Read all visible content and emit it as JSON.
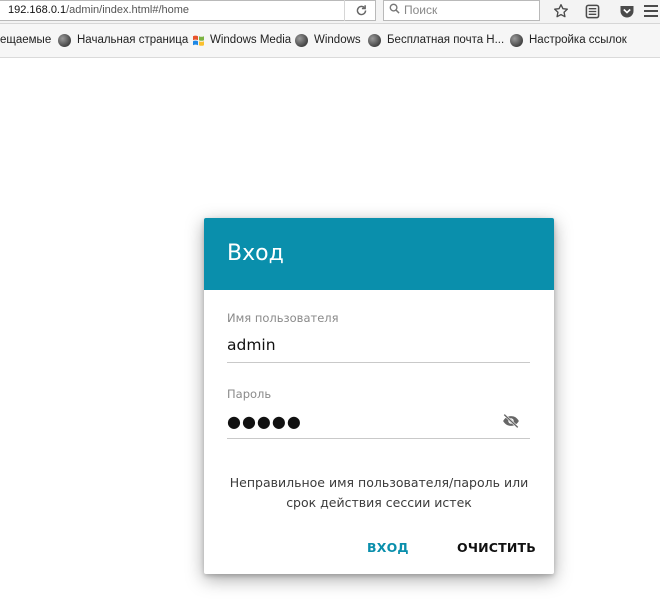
{
  "browser": {
    "url_host": "192.168.0.1",
    "url_path": "/admin/index.html#/home",
    "search_placeholder": "Поиск"
  },
  "bookmarks": [
    {
      "label": "ещаемые",
      "icon": "none"
    },
    {
      "label": "Начальная страница",
      "icon": "globe-icon"
    },
    {
      "label": "Windows Media",
      "icon": "windows-flag-icon"
    },
    {
      "label": "Windows",
      "icon": "globe-icon"
    },
    {
      "label": "Бесплатная почта Н...",
      "icon": "globe-icon"
    },
    {
      "label": "Настройка ссылок",
      "icon": "globe-icon"
    }
  ],
  "dialog": {
    "title": "Вход",
    "username_label": "Имя пользователя",
    "username_value": "admin",
    "password_label": "Пароль",
    "password_masked": "●●●●●",
    "error_line1": "Неправильное имя пользователя/пароль или",
    "error_line2": "срок действия сессии истек",
    "login_button": "ВХОД",
    "clear_button": "ОЧИСТИТЬ"
  },
  "colors": {
    "accent": "#0a8fac",
    "header_text": "#ffffff"
  }
}
